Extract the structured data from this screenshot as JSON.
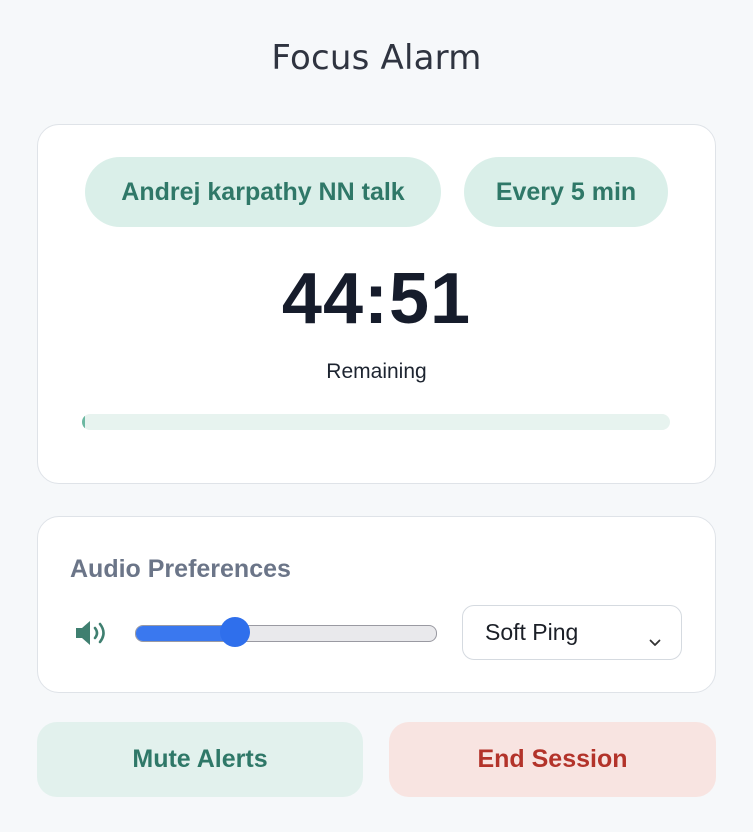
{
  "app": {
    "title": "Focus Alarm"
  },
  "session": {
    "name": "Andrej karpathy NN talk",
    "interval": "Every 5 min",
    "time_remaining": "44:51",
    "remaining_label": "Remaining",
    "progress_fraction": 0.005
  },
  "audio": {
    "heading": "Audio Preferences",
    "volume_fraction": 0.33,
    "sound_selected": "Soft Ping",
    "icons": {
      "volume": "speaker-volume-icon",
      "dropdown": "chevron-down-icon"
    }
  },
  "actions": {
    "mute_label": "Mute Alerts",
    "end_label": "End Session"
  },
  "colors": {
    "accent_green": "#2f7868",
    "pill_bg": "#daefe9",
    "slider_blue": "#3a78ef",
    "danger_red": "#b3332a",
    "danger_bg": "#f8e4e1"
  }
}
